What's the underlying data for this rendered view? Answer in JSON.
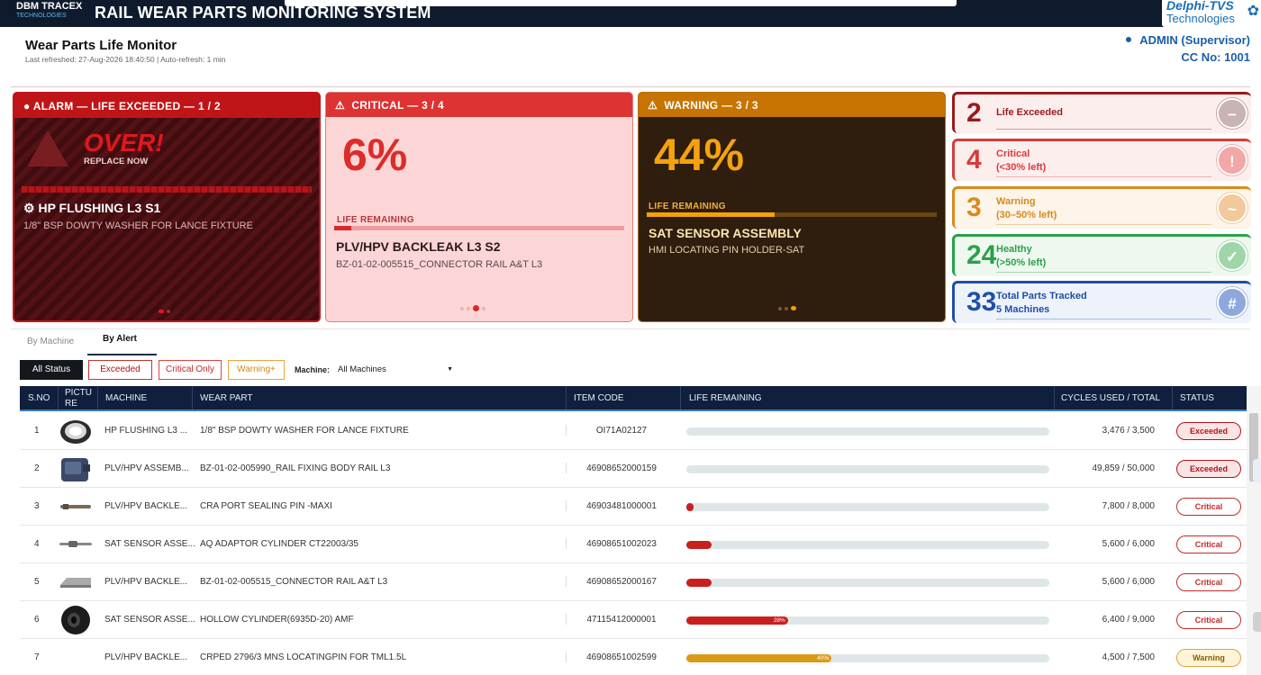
{
  "topbar": {
    "brand_name": "DBM TRACEX",
    "brand_sub": "TECHNOLOGIES",
    "app_title": "RAIL WEAR PARTS MONITORING SYSTEM",
    "partner_line1": "Delphi-TVS",
    "partner_line2": "Technologies"
  },
  "header": {
    "title": "Wear Parts Life Monitor",
    "refresh": "Last refreshed: 27-Aug-2026 18:40:50  |  Auto-refresh: 1 min",
    "user": "ADMIN  (Supervisor)",
    "cc": "CC No: 1001"
  },
  "cards": {
    "alarm": {
      "header": "ALARM  —  LIFE EXCEEDED  —  1 / 2",
      "big": "OVER!",
      "sub_big": "REPLACE NOW",
      "title": "HP FLUSHING L3 S1",
      "subtitle": "1/8\" BSP DOWTY WASHER FOR LANCE FIXTURE"
    },
    "critical": {
      "header": "CRITICAL  —  3 / 4",
      "pct": "6%",
      "life_label": "LIFE REMAINING",
      "life_fraction": 0.06,
      "title": "PLV/HPV BACKLEAK L3 S2",
      "subtitle": "BZ-01-02-005515_CONNECTOR RAIL A&T L3"
    },
    "warning": {
      "header": "WARNING  —  3 / 3",
      "pct": "44%",
      "life_label": "LIFE REMAINING",
      "life_fraction": 0.44,
      "title": "SAT SENSOR ASSEMBLY",
      "subtitle": "HMI LOCATING PIN HOLDER-SAT"
    }
  },
  "summary": [
    {
      "num": "2",
      "label1": "Life Exceeded",
      "label2": "",
      "icon": "minus-circle-icon",
      "glyph": "−",
      "color": "#9c1a1a",
      "bg": "#fdeeee",
      "line": "#c9a3a3",
      "iconbg": "#c9b3b3"
    },
    {
      "num": "4",
      "label1": "Critical",
      "label2": "(<30% left)",
      "icon": "exclamation-icon",
      "glyph": "!",
      "color": "#d93b3b",
      "bg": "#fdeeee",
      "line": "#e9b0b0",
      "iconbg": "#f2a8a8"
    },
    {
      "num": "3",
      "label1": "Warning",
      "label2": "(30–50% left)",
      "icon": "tilde-icon",
      "glyph": "~",
      "color": "#d98a1c",
      "bg": "#fdf4ea",
      "line": "#eccda3",
      "iconbg": "#f1c99a"
    },
    {
      "num": "24",
      "label1": "Healthy",
      "label2": "(>50% left)",
      "icon": "check-icon",
      "glyph": "✓",
      "color": "#2aa14a",
      "bg": "#eef8ef",
      "line": "#a9d9b2",
      "iconbg": "#9fd6a9"
    },
    {
      "num": "33",
      "label1": "Total Parts Tracked",
      "label2": "5 Machines",
      "icon": "hash-icon",
      "glyph": "#",
      "color": "#1f4fa8",
      "bg": "#eef2fa",
      "line": "#a9bde3",
      "iconbg": "#8ea7dc"
    }
  ],
  "tabs": {
    "by_machine": "By Machine",
    "by_alert": "By Alert"
  },
  "filters": {
    "all": "All Status",
    "exceeded": "Exceeded",
    "critical": "Critical Only",
    "warning": "Warning+",
    "machine_label": "Machine:",
    "machine_value": "All Machines"
  },
  "table": {
    "columns": [
      "S.NO",
      "PICTURE",
      "MACHINE",
      "WEAR PART",
      "ITEM CODE",
      "LIFE REMAINING",
      "CYCLES USED / TOTAL",
      "STATUS"
    ],
    "rows": [
      {
        "sno": "1",
        "machine": "HP FLUSHING L3 ...",
        "part": "1/8\" BSP DOWTY WASHER FOR LANCE FIXTURE",
        "code": "OI71A02127",
        "life": 0,
        "life_label": "",
        "cycles": "3,476 / 3,500",
        "status": "Exceeded",
        "thumb": "washer"
      },
      {
        "sno": "2",
        "machine": "PLV/HPV ASSEMB...",
        "part": "BZ-01-02-005990_RAIL FIXING BODY RAIL L3",
        "code": "46908652000159",
        "life": 0,
        "life_label": "",
        "cycles": "49,859 / 50,000",
        "status": "Exceeded",
        "thumb": "block"
      },
      {
        "sno": "3",
        "machine": "PLV/HPV BACKLE...",
        "part": "CRA PORT SEALING PIN -MAXI",
        "code": "46903481000001",
        "life": 0.02,
        "life_label": "",
        "cycles": "7,800 / 8,000",
        "status": "Critical",
        "thumb": "pin"
      },
      {
        "sno": "4",
        "machine": "SAT SENSOR ASSE...",
        "part": "AQ ADAPTOR CYLINDER CT22003/35",
        "code": "46908651002023",
        "life": 0.07,
        "life_label": "",
        "cycles": "5,600 / 6,000",
        "status": "Critical",
        "thumb": "rod"
      },
      {
        "sno": "5",
        "machine": "PLV/HPV BACKLE...",
        "part": "BZ-01-02-005515_CONNECTOR RAIL A&T L3",
        "code": "46908652000167",
        "life": 0.07,
        "life_label": "",
        "cycles": "5,600 / 6,000",
        "status": "Critical",
        "thumb": "rail"
      },
      {
        "sno": "6",
        "machine": "SAT SENSOR ASSE...",
        "part": "HOLLOW CYLINDER(6935D-20) AMF",
        "code": "47115412000001",
        "life": 0.28,
        "life_label": "28%",
        "cycles": "6,400 / 9,000",
        "status": "Critical",
        "thumb": "cylinder"
      },
      {
        "sno": "7",
        "machine": "PLV/HPV BACKLE...",
        "part": "CRPED 2796/3 MNS LOCATINGPIN FOR TML1.5L",
        "code": "46908651002599",
        "life": 0.4,
        "life_label": "40%",
        "cycles": "4,500 / 7,500",
        "status": "Warning",
        "thumb": "none"
      }
    ]
  },
  "colors": {
    "exceeded_text": "#b3131b",
    "exceeded_bg": "#fbe4e4",
    "critical_text": "#c62828",
    "critical_bg": "#ffffff",
    "warning_text": "#8a5a00",
    "warning_bg": "#fff4d8",
    "bar_critical": "#c91f1f",
    "bar_warning": "#d99a1a"
  }
}
